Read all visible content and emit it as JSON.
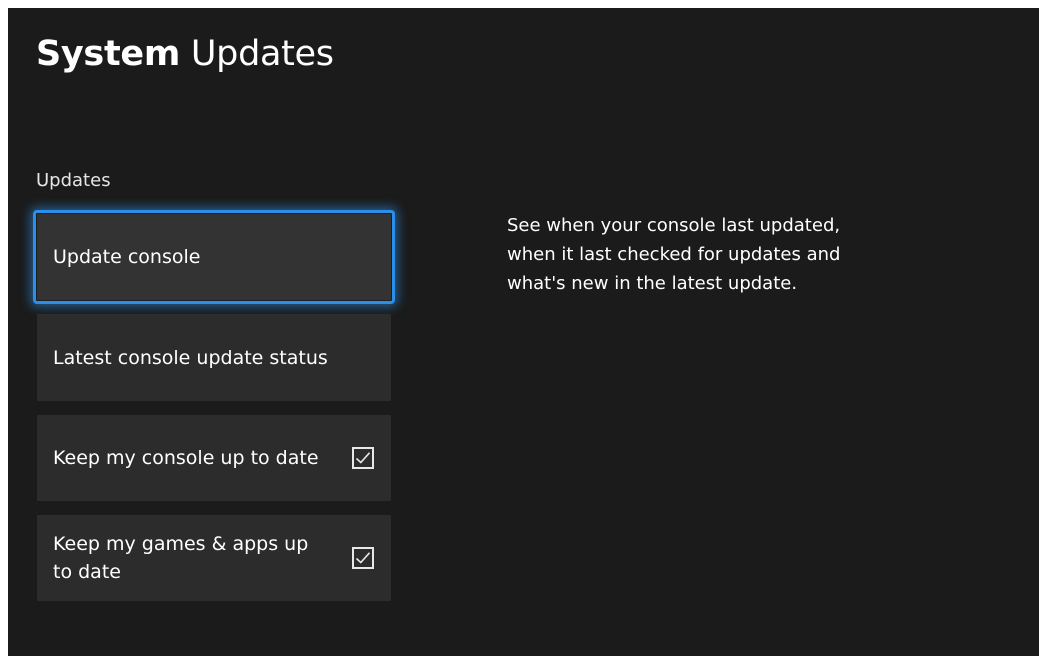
{
  "header": {
    "title_bold": "System",
    "title_regular": "Updates"
  },
  "section": {
    "label": "Updates"
  },
  "menu": {
    "items": [
      {
        "label": "Update console",
        "focused": true
      },
      {
        "label": "Latest console update status"
      },
      {
        "label": "Keep my console up to date",
        "checked": true
      },
      {
        "label": "Keep my games & apps up to date",
        "checked": true
      }
    ]
  },
  "description": {
    "lines": [
      "See when your console last updated,",
      "when it last checked for updates and",
      "what's new in the latest update."
    ]
  },
  "colors": {
    "background": "#1b1b1b",
    "tile": "#2c2c2c",
    "focus_ring": "#2b8ee8",
    "text": "#ffffff"
  }
}
